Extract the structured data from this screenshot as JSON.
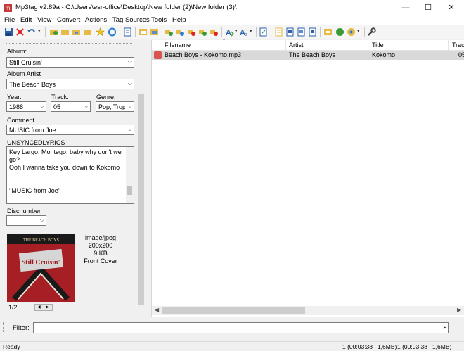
{
  "window": {
    "title": "Mp3tag v2.89a  -  C:\\Users\\esr-office\\Desktop\\New folder (2)\\New folder (3)\\",
    "minimize": "—",
    "maximize": "☐",
    "close": "✕"
  },
  "menu": [
    "File",
    "Edit",
    "View",
    "Convert",
    "Actions",
    "Tag Sources",
    "Tools",
    "Help"
  ],
  "fields": {
    "album_label": "Album:",
    "album_value": "Still Cruisin'",
    "album_artist_label": "Album Artist",
    "album_artist_value": "The Beach Boys",
    "year_label": "Year:",
    "year_value": "1988",
    "track_label": "Track:",
    "track_value": "05",
    "genre_label": "Genre:",
    "genre_value": "Pop, Trop",
    "comment_label": "Comment",
    "comment_value": "MUSIC from Joe",
    "lyrics_label": "UNSYNCEDLYRICS",
    "lyrics_value": "Key Largo, Montego, baby why don't we go?\nOoh I wanna take you down to Kokomo\n\n\n\"MUSIC from Joe\"",
    "discnumber_label": "Discnumber",
    "discnumber_value": ""
  },
  "cover": {
    "mime": "image/jpeg",
    "dimensions": "200x200",
    "size": "9 KB",
    "type": "Front Cover",
    "index": "1/2",
    "artwork_band": "THE BEACH BOYS",
    "artwork_title": "Still Cruisin'"
  },
  "filelist": {
    "columns": [
      "Filename",
      "Artist",
      "Title",
      "Trac"
    ],
    "rows": [
      {
        "filename": "Beach Boys - Kokomo.mp3",
        "artist": "The Beach Boys",
        "title": "Kokomo",
        "track": "05"
      }
    ]
  },
  "filter": {
    "label": "Filter:",
    "value": ""
  },
  "status": {
    "left": "Ready",
    "mid": "1 (00:03:38 | 1,6MB)",
    "right": "1 (00:03:38 | 1,6MB)"
  },
  "colors": {
    "accent": "#0a64c8",
    "selection": "#d9d9d9",
    "art": "#b3272b"
  }
}
